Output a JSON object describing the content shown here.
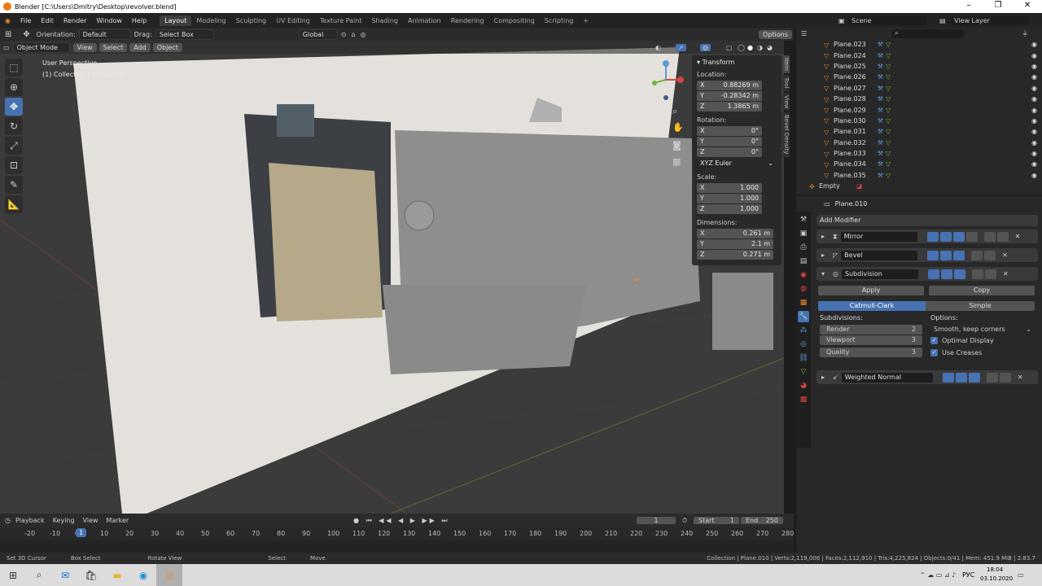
{
  "window": {
    "title": "Blender [C:\\Users\\Dmitry\\Desktop\\revolver.blend]"
  },
  "menu": [
    "File",
    "Edit",
    "Render",
    "Window",
    "Help"
  ],
  "workspaces": [
    "Layout",
    "Modeling",
    "Sculpting",
    "UV Editing",
    "Texture Paint",
    "Shading",
    "Animation",
    "Rendering",
    "Compositing",
    "Scripting"
  ],
  "scene": {
    "scene_label": "Scene",
    "view_layer_label": "View Layer"
  },
  "toolheader": {
    "orientation_label": "Orientation:",
    "orientation_value": "Default",
    "drag_label": "Drag:",
    "drag_value": "Select Box",
    "transform_space": "Global",
    "options": "Options"
  },
  "viewport_header": {
    "mode": "Object Mode",
    "view": "View",
    "select": "Select",
    "add": "Add",
    "object": "Object"
  },
  "viewport_info": {
    "perspective": "User Perspective",
    "collection": "(1) Collection | Plane.010"
  },
  "transform": {
    "title": "Transform",
    "location_label": "Location:",
    "location": [
      {
        "axis": "X",
        "value": "0.88269 m"
      },
      {
        "axis": "Y",
        "value": "-0.28342 m"
      },
      {
        "axis": "Z",
        "value": "1.3865 m"
      }
    ],
    "rotation_label": "Rotation:",
    "rotation": [
      {
        "axis": "X",
        "value": "0°"
      },
      {
        "axis": "Y",
        "value": "0°"
      },
      {
        "axis": "Z",
        "value": "0°"
      }
    ],
    "rotation_mode": "XYZ Euler",
    "scale_label": "Scale:",
    "scale": [
      {
        "axis": "X",
        "value": "1.000"
      },
      {
        "axis": "Y",
        "value": "1.000"
      },
      {
        "axis": "Z",
        "value": "1.000"
      }
    ],
    "dimensions_label": "Dimensions:",
    "dimensions": [
      {
        "axis": "X",
        "value": "0.261 m"
      },
      {
        "axis": "Y",
        "value": "2.1 m"
      },
      {
        "axis": "Z",
        "value": "0.271 m"
      }
    ]
  },
  "sidetabs": [
    "Item",
    "Tool",
    "View",
    "Bevel Density"
  ],
  "outliner": {
    "items": [
      "Plane.023",
      "Plane.024",
      "Plane.025",
      "Plane.026",
      "Plane.027",
      "Plane.028",
      "Plane.029",
      "Plane.030",
      "Plane.031",
      "Plane.032",
      "Plane.033",
      "Plane.034",
      "Plane.035"
    ],
    "empty": "Empty"
  },
  "properties": {
    "object_name": "Plane.010",
    "add_modifier": "Add Modifier",
    "modifiers": [
      "Mirror",
      "Bevel",
      "Subdivision",
      "Weighted Normal"
    ],
    "apply": "Apply",
    "copy": "Copy",
    "catmull": "Catmull-Clark",
    "simple": "Simple",
    "subdivisions_label": "Subdivisions:",
    "render_label": "Render",
    "render_value": "2",
    "viewport_label": "Viewport",
    "viewport_value": "3",
    "quality_label": "Quality",
    "quality_value": "3",
    "options_label": "Options:",
    "uv_smooth": "Smooth, keep corners",
    "optimal_display": "Optimal Display",
    "use_creases": "Use Creases"
  },
  "timeline": {
    "playback": "Playback",
    "keying": "Keying",
    "view": "View",
    "marker": "Marker",
    "current": "1",
    "start_label": "Start",
    "start": "1",
    "end_label": "End",
    "end": "250",
    "ticks": [
      "-20",
      "-10",
      "0",
      "10",
      "20",
      "30",
      "40",
      "50",
      "60",
      "70",
      "80",
      "90",
      "100",
      "110",
      "120",
      "130",
      "140",
      "150",
      "160",
      "170",
      "180",
      "190",
      "200",
      "210",
      "220",
      "230",
      "240",
      "250",
      "260",
      "270",
      "280"
    ],
    "frame_marker": "1"
  },
  "status": {
    "set_cursor": "Set 3D Cursor",
    "box_select": "Box Select",
    "rotate_view": "Rotate View",
    "select": "Select",
    "move": "Move",
    "stats": "Collection | Plane.010 | Verts:2,119,006 | Faces:2,112,910 | Tris:4,225,824 | Objects:0/41 | Mem: 451.9 MiB | 2.83.7"
  },
  "taskbar": {
    "lang": "РУС",
    "time": "18:04",
    "date": "03.10.2020"
  }
}
